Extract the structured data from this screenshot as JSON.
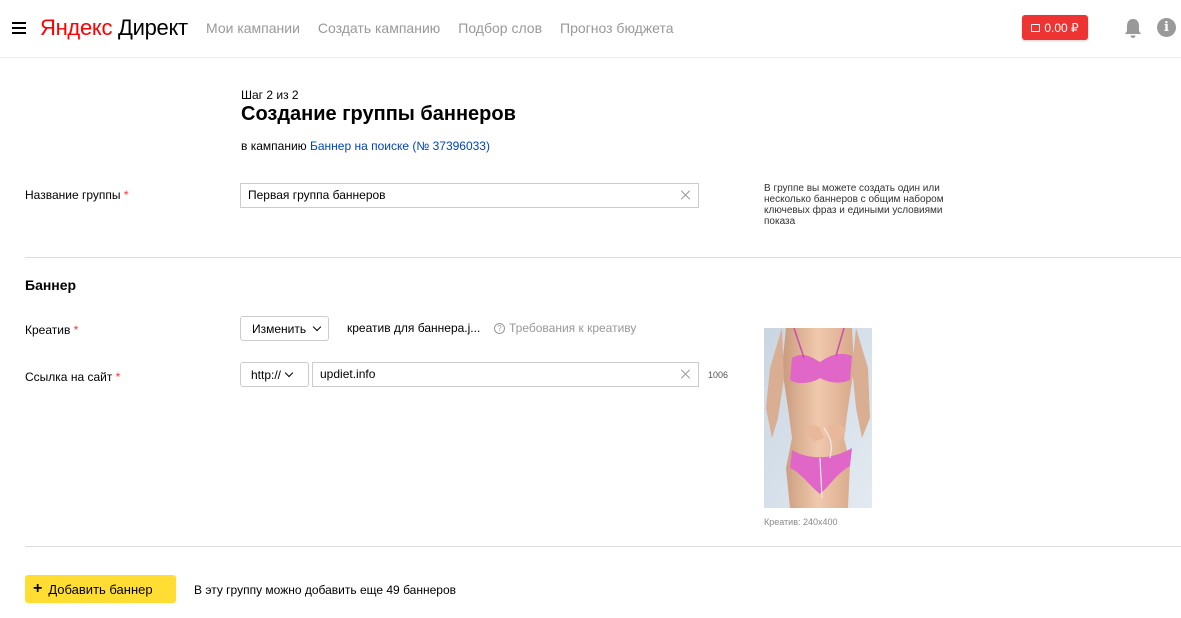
{
  "header": {
    "logo_yandex": "Яндекс",
    "logo_direct": "Директ",
    "nav": [
      {
        "label": "Мои кампании"
      },
      {
        "label": "Создать кампанию"
      },
      {
        "label": "Подбор слов"
      },
      {
        "label": "Прогноз бюджета"
      }
    ],
    "balance": "0.00 ₽",
    "info_glyph": "i"
  },
  "page": {
    "step": "Шаг 2 из 2",
    "title": "Создание группы баннеров",
    "campaign_prefix": "в кампанию",
    "campaign_link": "Баннер на поиске (№ 37396033)"
  },
  "group": {
    "label": "Название группы",
    "required": "*",
    "value": "Первая группа баннеров",
    "hint": "В группе вы можете создать один или несколько баннеров с общим набором ключевых фраз и едиными условиями показа"
  },
  "banner": {
    "section_title": "Баннер",
    "creative_label": "Креатив",
    "change_button": "Изменить",
    "creative_file": "креатив для баннера.j...",
    "requirements_link": "Требования к креативу",
    "requirements_icon": "?",
    "link_label": "Ссылка на сайт",
    "protocol": "http://",
    "url_value": "updiet.info",
    "chars_left": "1006",
    "creative_caption": "Креатив: 240x400"
  },
  "footer": {
    "add_button": "Добавить баннер",
    "add_plus": "+",
    "add_note": "В эту группу можно добавить еще 49 баннеров"
  },
  "colors": {
    "accent_red": "#ee3333",
    "link_blue": "#0044bb",
    "button_yellow": "#ffdd33"
  }
}
